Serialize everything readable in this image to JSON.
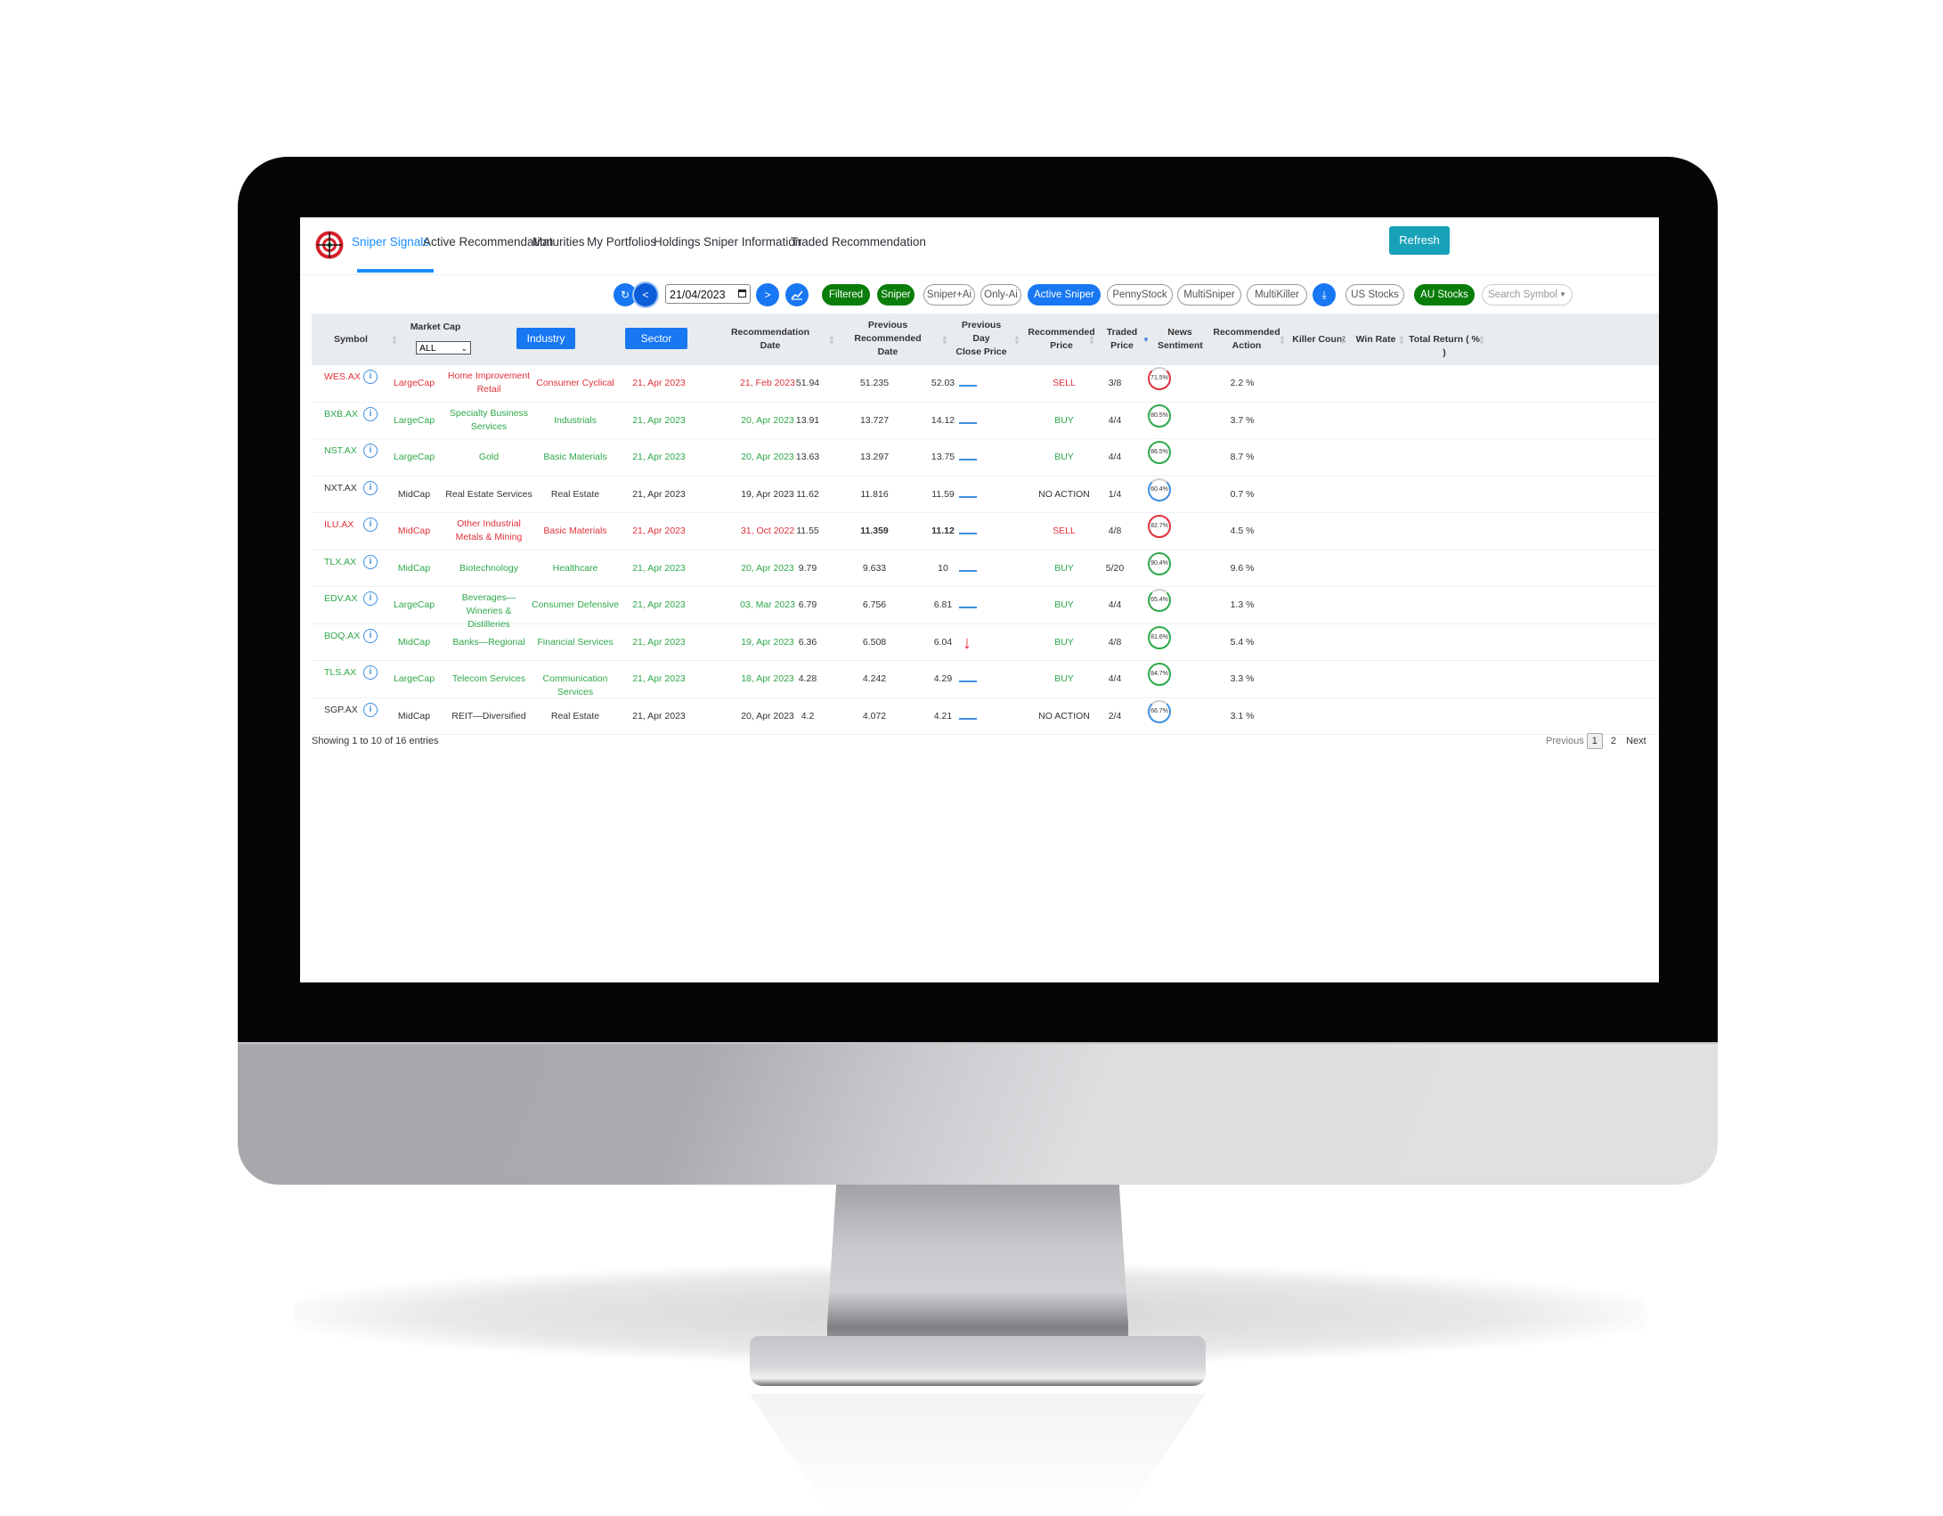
{
  "nav": {
    "items": [
      {
        "label": "Sniper Signals",
        "active": true
      },
      {
        "label": "Active Recommendation",
        "active": false
      },
      {
        "label": "Maturities",
        "active": false
      },
      {
        "label": "My Portfolios",
        "active": false
      },
      {
        "label": "Holdings",
        "active": false
      },
      {
        "label": "Sniper Information",
        "active": false
      },
      {
        "label": "Traded Recommendation",
        "active": false
      }
    ],
    "refresh_label": "Refresh"
  },
  "toolbar": {
    "reload_icon": "sync-icon",
    "prev_label": "<",
    "date_value": "21/04/2023",
    "next_label": ">",
    "chart_icon": "line-chart-icon",
    "download_icon": "download-icon",
    "filters": [
      {
        "label": "Filtered",
        "style": "green"
      },
      {
        "label": "Sniper",
        "style": "green"
      },
      {
        "label": "Sniper+Ai",
        "style": "outline"
      },
      {
        "label": "Only-Ai",
        "style": "outline"
      },
      {
        "label": "Active Sniper",
        "style": "blue"
      },
      {
        "label": "PennyStock",
        "style": "outline"
      },
      {
        "label": "MultiSniper",
        "style": "outline"
      },
      {
        "label": "MultiKiller",
        "style": "outline"
      },
      {
        "label": "US Stocks",
        "style": "outline"
      },
      {
        "label": "AU Stocks",
        "style": "green"
      }
    ],
    "search_placeholder": "Search Symbol"
  },
  "table": {
    "headers": {
      "symbol": "Symbol",
      "market_cap": "Market Cap",
      "market_cap_selected": "ALL",
      "industry": "Industry",
      "sector": "Sector",
      "rec_date": [
        "Recommendation",
        "Date"
      ],
      "prev_rec_date": [
        "Previous",
        "Recommended",
        "Date"
      ],
      "prev_close": [
        "Previous",
        "Day",
        "Close Price"
      ],
      "rec_price": [
        "Recommended",
        "Price"
      ],
      "traded_price": [
        "Traded",
        "Price"
      ],
      "news": [
        "News",
        "Sentiment"
      ],
      "rec_action": [
        "Recommended",
        "Action"
      ],
      "killer_count": "Killer Count",
      "win_rate": "Win Rate",
      "total_return": "Total Return ( % )"
    },
    "rows": [
      {
        "symbol": "WES.AX",
        "color": "red",
        "cap": "LargeCap",
        "industry": "Home Improvement Retail",
        "sector": "Consumer Cyclical",
        "rec_date": "21, Apr 2023",
        "prev_date": "21, Feb 2023",
        "prev_close": "51.94",
        "rec_price": "51.235",
        "traded": "52.03",
        "news": "neutral",
        "action": "SELL",
        "action_color": "red",
        "killer": "3/8",
        "win": "71.5%",
        "win_color": "red",
        "win_value": 71.5,
        "ret": "2.2 %"
      },
      {
        "symbol": "BXB.AX",
        "color": "green",
        "cap": "LargeCap",
        "industry": "Specialty Business Services",
        "sector": "Industrials",
        "rec_date": "21, Apr 2023",
        "prev_date": "20, Apr 2023",
        "prev_close": "13.91",
        "rec_price": "13.727",
        "traded": "14.12",
        "news": "neutral",
        "action": "BUY",
        "action_color": "green",
        "killer": "4/4",
        "win": "80.5%",
        "win_color": "green",
        "win_value": 80.5,
        "ret": "3.7 %"
      },
      {
        "symbol": "NST.AX",
        "color": "green",
        "cap": "LargeCap",
        "industry": "Gold",
        "sector": "Basic Materials",
        "rec_date": "21, Apr 2023",
        "prev_date": "20, Apr 2023",
        "prev_close": "13.63",
        "rec_price": "13.297",
        "traded": "13.75",
        "news": "neutral",
        "action": "BUY",
        "action_color": "green",
        "killer": "4/4",
        "win": "86.5%",
        "win_color": "green",
        "win_value": 86.5,
        "ret": "8.7 %"
      },
      {
        "symbol": "NXT.AX",
        "color": "dark",
        "cap": "MidCap",
        "industry": "Real Estate Services",
        "sector": "Real Estate",
        "rec_date": "21, Apr 2023",
        "prev_date": "19, Apr 2023",
        "prev_close": "11.62",
        "rec_price": "11.816",
        "traded": "11.59",
        "news": "neutral",
        "action": "NO ACTION",
        "action_color": "dark",
        "killer": "1/4",
        "win": "60.4%",
        "win_color": "blue",
        "win_value": 60.4,
        "ret": "0.7 %"
      },
      {
        "symbol": "ILU.AX",
        "color": "red",
        "cap": "MidCap",
        "industry": "Other Industrial Metals & Mining",
        "sector": "Basic Materials",
        "rec_date": "21, Apr 2023",
        "prev_date": "31, Oct 2022",
        "prev_close": "11.55",
        "rec_price": "11.359",
        "traded": "11.12",
        "news": "neutral",
        "action": "SELL",
        "action_color": "red",
        "killer": "4/8",
        "win": "82.7%",
        "win_color": "red",
        "win_value": 82.7,
        "ret": "4.5 %",
        "bold_prices": true
      },
      {
        "symbol": "TLX.AX",
        "color": "green",
        "cap": "MidCap",
        "industry": "Biotechnology",
        "sector": "Healthcare",
        "rec_date": "21, Apr 2023",
        "prev_date": "20, Apr 2023",
        "prev_close": "9.79",
        "rec_price": "9.633",
        "traded": "10",
        "news": "neutral",
        "action": "BUY",
        "action_color": "green",
        "killer": "5/20",
        "win": "90.4%",
        "win_color": "green",
        "win_value": 90.4,
        "ret": "9.6 %"
      },
      {
        "symbol": "EDV.AX",
        "color": "green",
        "cap": "LargeCap",
        "industry": "Beverages—Wineries & Distilleries",
        "sector": "Consumer Defensive",
        "rec_date": "21, Apr 2023",
        "prev_date": "03, Mar 2023",
        "prev_close": "6.79",
        "rec_price": "6.756",
        "traded": "6.81",
        "news": "neutral",
        "action": "BUY",
        "action_color": "green",
        "killer": "4/4",
        "win": "65.4%",
        "win_color": "green",
        "win_value": 65.4,
        "ret": "1.3 %"
      },
      {
        "symbol": "BOQ.AX",
        "color": "green",
        "cap": "MidCap",
        "industry": "Banks—Regional",
        "sector": "Financial Services",
        "rec_date": "21, Apr 2023",
        "prev_date": "19, Apr 2023",
        "prev_close": "6.36",
        "rec_price": "6.508",
        "traded": "6.04",
        "news": "negative",
        "action": "BUY",
        "action_color": "green",
        "killer": "4/8",
        "win": "81.6%",
        "win_color": "green",
        "win_value": 81.6,
        "ret": "5.4 %"
      },
      {
        "symbol": "TLS.AX",
        "color": "green",
        "cap": "LargeCap",
        "industry": "Telecom Services",
        "sector": "Communication Services",
        "rec_date": "21, Apr 2023",
        "prev_date": "18, Apr 2023",
        "prev_close": "4.28",
        "rec_price": "4.242",
        "traded": "4.29",
        "news": "neutral",
        "action": "BUY",
        "action_color": "green",
        "killer": "4/4",
        "win": "84.7%",
        "win_color": "green",
        "win_value": 84.7,
        "ret": "3.3 %"
      },
      {
        "symbol": "SGP.AX",
        "color": "dark",
        "cap": "MidCap",
        "industry": "REIT—Diversified",
        "sector": "Real Estate",
        "rec_date": "21, Apr 2023",
        "prev_date": "20, Apr 2023",
        "prev_close": "4.2",
        "rec_price": "4.072",
        "traded": "4.21",
        "news": "neutral",
        "action": "NO ACTION",
        "action_color": "dark",
        "killer": "2/4",
        "win": "66.7%",
        "win_color": "blue",
        "win_value": 66.7,
        "ret": "3.1 %"
      }
    ],
    "footer_info": "Showing 1 to 10 of 16 entries",
    "pager": {
      "previous": "Previous",
      "pages": [
        "1",
        "2"
      ],
      "current": "1",
      "next": "Next"
    }
  },
  "colors": {
    "red": "#e0303a",
    "green": "#2ea84a",
    "dark": "#333333",
    "blue": "#3d8fe0",
    "brand_blue": "#1877f2",
    "filter_green": "#0a7d0a",
    "refresh_teal": "#17a2b8"
  }
}
